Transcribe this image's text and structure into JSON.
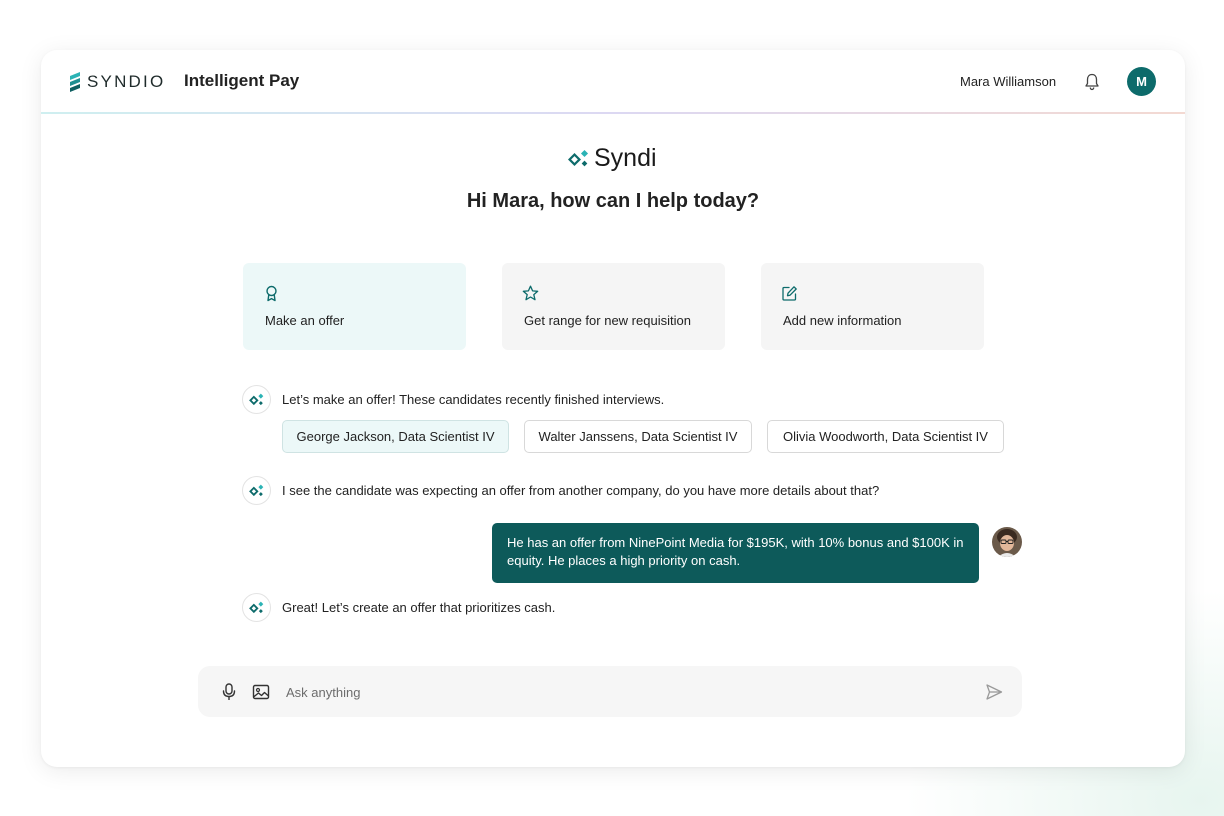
{
  "header": {
    "brand": "SYNDIO",
    "product": "Intelligent Pay",
    "user_name": "Mara Williamson",
    "avatar_initial": "M"
  },
  "assistant": {
    "name": "Syndi",
    "greeting": "Hi Mara, how can I help today?"
  },
  "quick_actions": [
    {
      "label": "Make an offer",
      "icon": "award-icon",
      "active": true
    },
    {
      "label": "Get range for new requisition",
      "icon": "star-icon",
      "active": false
    },
    {
      "label": "Add new information",
      "icon": "edit-icon",
      "active": false
    }
  ],
  "conversation": {
    "msg1": "Let’s make an offer! These candidates recently finished interviews.",
    "candidates": [
      {
        "label": "George Jackson, Data Scientist IV",
        "selected": true
      },
      {
        "label": "Walter Janssens, Data Scientist IV",
        "selected": false
      },
      {
        "label": "Olivia Woodworth, Data Scientist IV",
        "selected": false
      }
    ],
    "msg2": "I see the candidate was expecting an offer from another company, do you have more details about that?",
    "user_reply": "He has an offer from NinePoint Media for $195K, with 10% bonus and $100K in equity. He places a high priority on cash.",
    "msg3": "Great! Let’s create an offer that prioritizes cash."
  },
  "composer": {
    "placeholder": "Ask anything",
    "value": ""
  },
  "colors": {
    "accent": "#0d6b6b",
    "bubble": "#0d5a5a",
    "active_card": "#ecf8f8",
    "logo_teal": "#2bb3b5"
  }
}
